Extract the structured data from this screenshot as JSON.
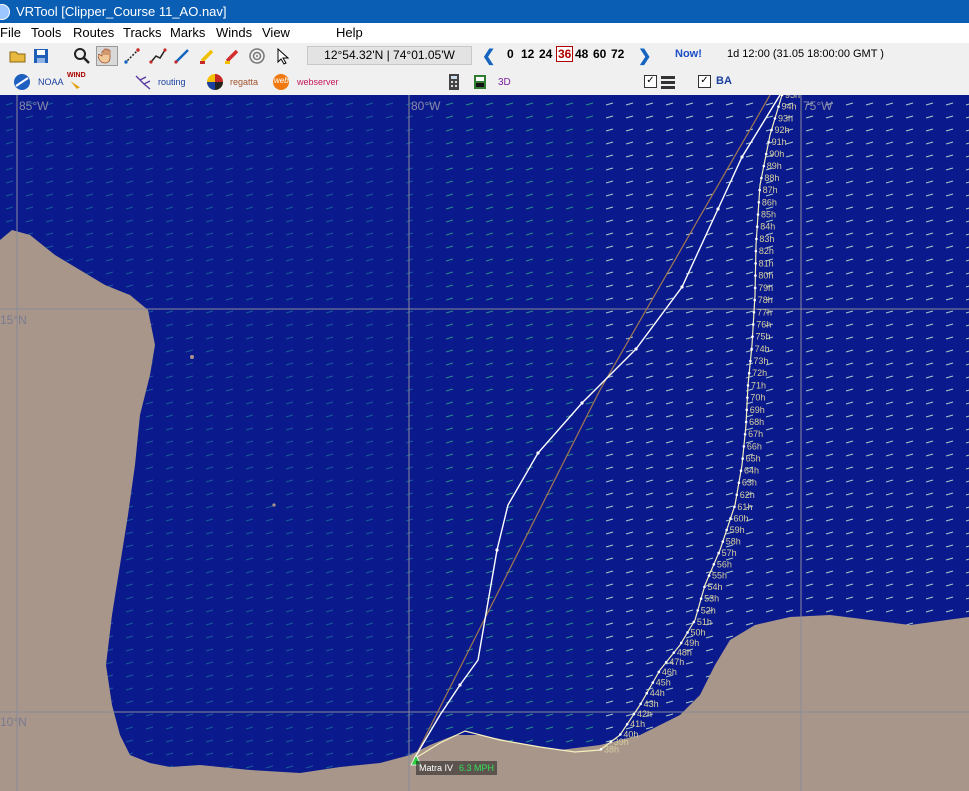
{
  "window": {
    "title": "VRTool [Clipper_Course 11_AO.nav]"
  },
  "menu": [
    "File",
    "Tools",
    "Routes",
    "Tracks",
    "Marks",
    "Winds",
    "View",
    "Help"
  ],
  "toolbar": {
    "coords": "12°54.32'N | 74°01.05'W",
    "hours": [
      "0",
      "12",
      "24",
      "36",
      "48",
      "60",
      "72"
    ],
    "selected_hour": "36",
    "now_label": "Now!",
    "time_info": "1d 12:00 (31.05 18:00:00 GMT )"
  },
  "toolbar2": {
    "noaa": "NOAA",
    "wind": "WIND",
    "routing": "routing",
    "regatta": "regatta",
    "web": "web",
    "webserver": "webserver",
    "three_d": "3D",
    "ba_label": "BA"
  },
  "map": {
    "lon_labels": [
      "85°W",
      "80°W",
      "75°W"
    ],
    "lat_labels": [
      "15°N",
      "10°N"
    ],
    "hour_labels": [
      "95h",
      "94h",
      "93h",
      "92h",
      "91h",
      "90h",
      "89h",
      "88h",
      "87h",
      "86h",
      "85h",
      "84h",
      "83h",
      "82h",
      "81h",
      "80h",
      "79h",
      "78h",
      "77h",
      "76h",
      "75h",
      "74h",
      "73h",
      "72h",
      "71h",
      "70h",
      "69h",
      "68h",
      "67h",
      "66h",
      "65h",
      "64h",
      "63h",
      "62h",
      "61h",
      "60h",
      "59h",
      "58h",
      "57h",
      "56h",
      "55h",
      "54h",
      "53h",
      "52h",
      "51h",
      "50h",
      "49h",
      "48h",
      "47h",
      "46h",
      "45h",
      "44h",
      "43h",
      "42h",
      "41h",
      "40h",
      "39h",
      "38h"
    ],
    "boat": {
      "name": "Matra IV",
      "speed": "6.3 MPH"
    },
    "colors": {
      "sea": "#0a1a8c",
      "land": "#a8968a",
      "grid": "#8a8a9a",
      "route_white": "#ffffff",
      "route_brown": "#a07850",
      "isochrone": "#e8e0a0"
    }
  }
}
